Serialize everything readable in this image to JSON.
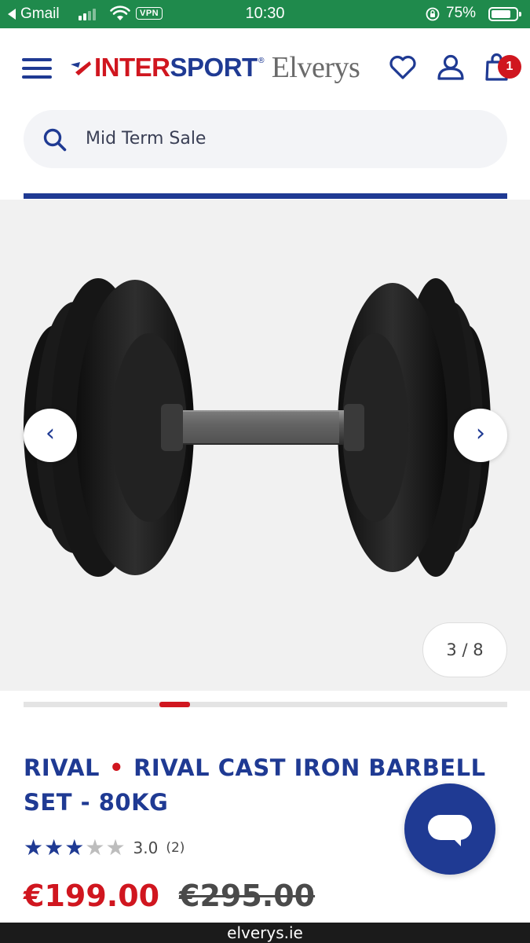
{
  "status_bar": {
    "back_app": "Gmail",
    "vpn": "VPN",
    "time": "10:30",
    "battery": "75%"
  },
  "header": {
    "logo_part1": "INTER",
    "logo_part2": "SPORT",
    "logo_registered": "®",
    "logo_part3": "Elverys",
    "cart_count": "1",
    "icons": [
      "menu-icon",
      "heart-icon",
      "user-icon",
      "shopping-bag-icon"
    ]
  },
  "search": {
    "placeholder": "Mid Term Sale"
  },
  "gallery": {
    "prev_label": "‹",
    "next_label": "›",
    "counter": "3 / 8",
    "current_image": 3,
    "total_images": 8
  },
  "product": {
    "brand": "RIVAL",
    "separator": "•",
    "name": "RIVAL CAST IRON BARBELL SET - 80KG",
    "rating_value": "3.0",
    "rating_count": "(2)",
    "stars": 3,
    "price_now": "€199.00",
    "price_was": "€295.00"
  },
  "browser": {
    "url": "elverys.ie"
  },
  "colors": {
    "status_green": "#1f8a4c",
    "brand_blue": "#1f3a93",
    "brand_red": "#d0161f",
    "gallery_bg": "#f1f1f1"
  }
}
